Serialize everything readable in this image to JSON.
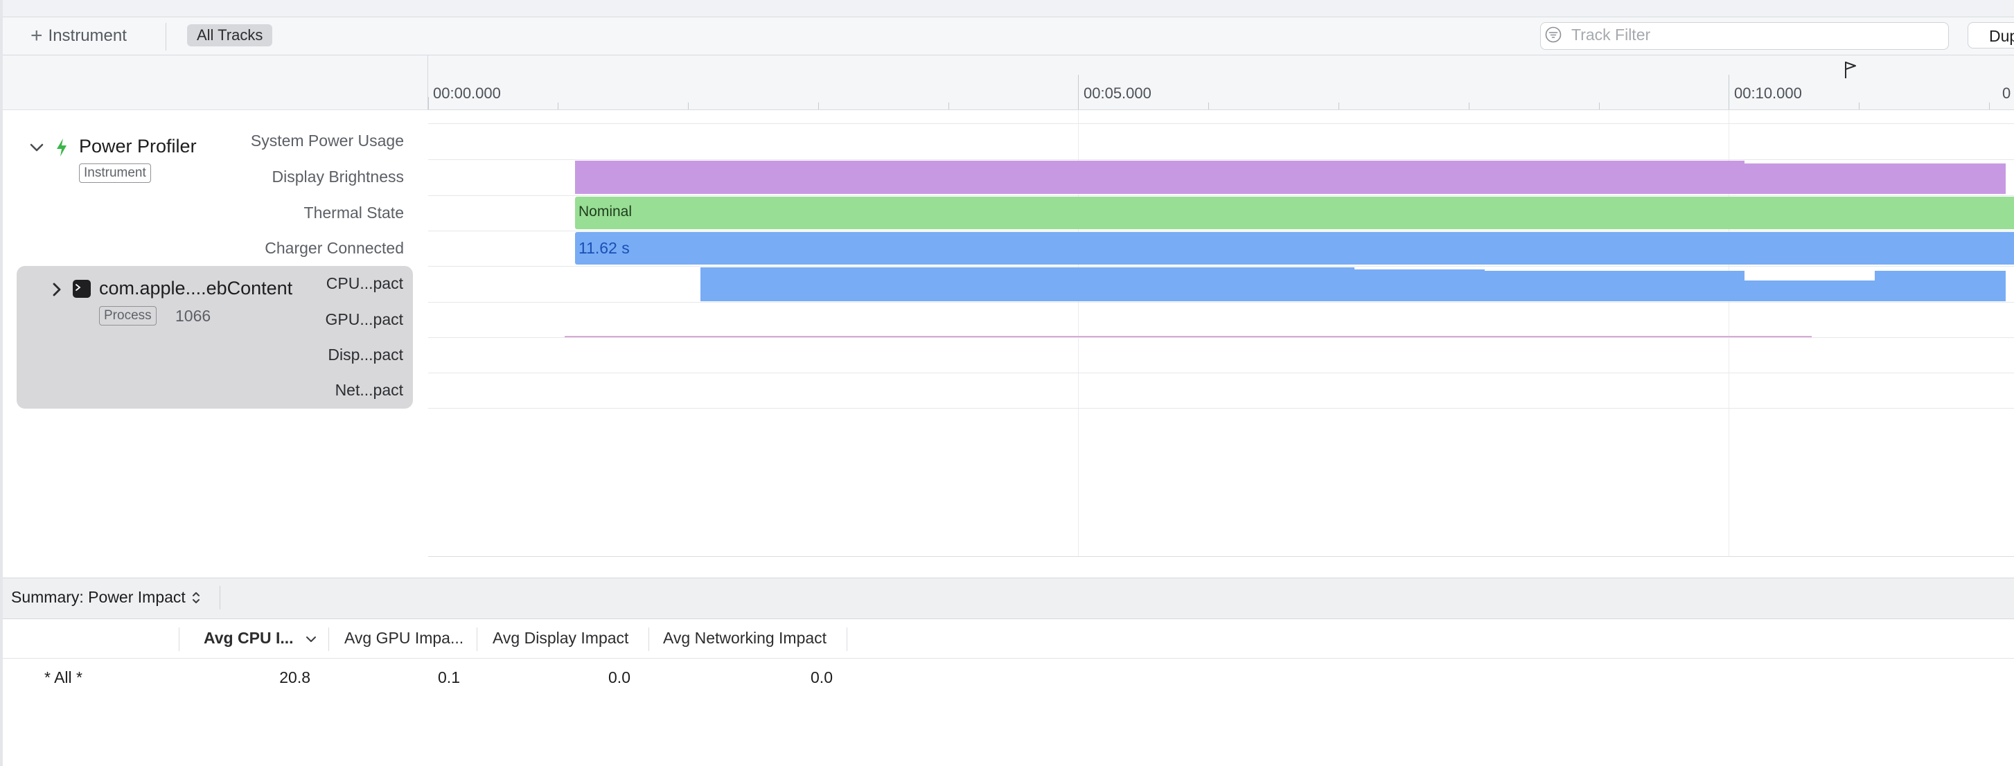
{
  "toolbar": {
    "add_instrument_label": "Instrument",
    "all_tracks_label": "All Tracks",
    "track_filter_placeholder": "Track Filter",
    "dup_label": "Dup"
  },
  "ruler": {
    "ticks": [
      "00:00.000",
      "00:05.000",
      "00:10.000",
      "0"
    ]
  },
  "instrument": {
    "name": "Power Profiler",
    "badge": "Instrument",
    "tracks": [
      "System Power Usage",
      "Display Brightness",
      "Thermal State",
      "Charger Connected"
    ]
  },
  "process": {
    "name": "com.apple....ebContent",
    "badge": "Process",
    "pid": "1066",
    "tracks": [
      "CPU...pact",
      "GPU...pact",
      "Disp...pact",
      "Net...pact"
    ]
  },
  "graph": {
    "thermal_state_text": "Nominal",
    "charger_text": "11.62 s",
    "colors": {
      "brightness": "#c899e3",
      "thermal": "#98de95",
      "charger": "#78acf5",
      "cpu": "#78acf5"
    }
  },
  "summary": {
    "label": "Summary: Power Impact",
    "columns": [
      "Avg CPU I...",
      "Avg GPU Impa...",
      "Avg Display Impact",
      "Avg Networking Impact"
    ],
    "rows": [
      {
        "name": "* All *",
        "cpu": "20.8",
        "gpu": "0.1",
        "display": "0.0",
        "networking": "0.0"
      }
    ]
  }
}
